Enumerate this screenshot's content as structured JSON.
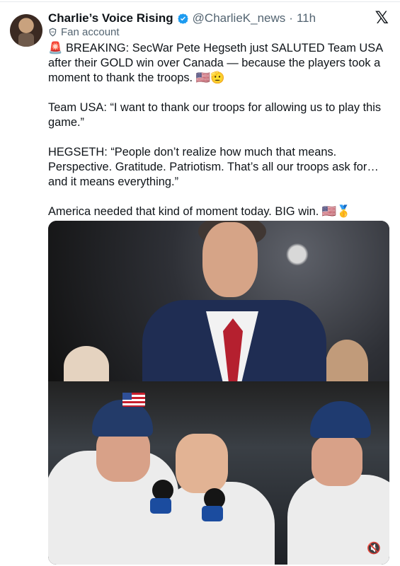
{
  "post": {
    "author_name": "Charlie’s Voice Rising",
    "handle": "@CharlieK_news",
    "separator": "·",
    "time": "11h",
    "fan_label": "Fan account",
    "paragraphs": [
      "🚨 BREAKING: SecWar Pete Hegseth just SALUTED Team USA after their GOLD win over Canada — because the players took a moment to thank the troops. 🇺🇸🫡",
      "Team USA: “I want to thank our troops for allowing us to play this game.”",
      "HEGSETH: “People don’t realize how much that means. Perspective. Gratitude. Patriotism. That’s all our troops ask for… and it means everything.”",
      "America needed that kind of moment today. BIG win. 🇺🇸🥇"
    ]
  },
  "branding": {
    "x_logo": "𝕏"
  },
  "icons": {
    "verified": "verified-badge-icon",
    "fan_account": "fan-account-icon",
    "mute": "mute-icon"
  },
  "colors": {
    "verified_blue": "#1d9bf0",
    "muted_text": "#536471"
  }
}
